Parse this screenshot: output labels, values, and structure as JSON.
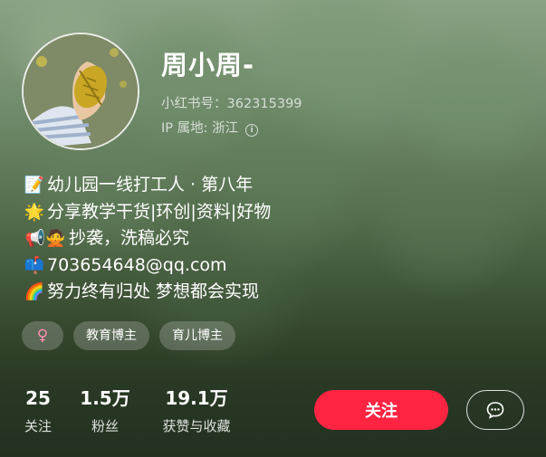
{
  "profile": {
    "name": "周小周-",
    "id_label": "小红书号：362315399",
    "ip_label": "IP 属地: 浙江",
    "info_icon": "info-icon"
  },
  "bio": [
    {
      "icon": "📝",
      "icon_name": "memo-icon",
      "text": "幼儿园一线打工人 · 第八年"
    },
    {
      "icon": "🌟",
      "icon_name": "star-icon",
      "text": "分享教学干货|环创|资料|好物"
    },
    {
      "icon": "📢🙅",
      "icon_name": "megaphone-no-gesture-icon",
      "text": "抄袭，洗稿必究"
    },
    {
      "icon": "📫",
      "icon_name": "mailbox-icon",
      "text": "703654648@qq.com"
    },
    {
      "icon": "🌈",
      "icon_name": "rainbow-icon",
      "text": "努力终有归处 梦想都会实现"
    }
  ],
  "tags": {
    "gender_icon": "♀",
    "items": [
      "教育博主",
      "育儿博主"
    ]
  },
  "stats": [
    {
      "num": "25",
      "label": "关注"
    },
    {
      "num": "1.5万",
      "label": "粉丝"
    },
    {
      "num": "19.1万",
      "label": "获赞与收藏"
    }
  ],
  "actions": {
    "follow_label": "关注",
    "message_icon": "chat-bubble-icon"
  },
  "colors": {
    "follow_button": "#ff2442",
    "female_icon": "#ff8fb0"
  }
}
